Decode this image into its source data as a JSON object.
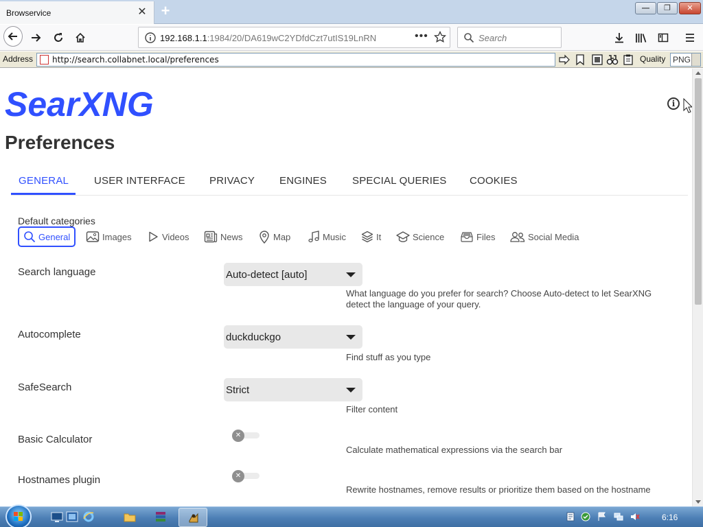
{
  "browser": {
    "tab_title": "Browservice",
    "tab_close": "✕",
    "new_tab": "+",
    "url_host": "192.168.1.1",
    "url_rest": ":1984/20/DA619wC2YDfdCzt7utIS19LnRN",
    "search_placeholder": "Search",
    "more_dots": "•••"
  },
  "addressbar": {
    "label": "Address",
    "url": "http://search.collabnet.local/preferences",
    "quality_label": "Quality",
    "quality_value": "PNG"
  },
  "page": {
    "logo": "SearXNG",
    "info_icon": "i",
    "title": "Preferences",
    "tabs": [
      {
        "label": "GENERAL"
      },
      {
        "label": "USER INTERFACE"
      },
      {
        "label": "PRIVACY"
      },
      {
        "label": "ENGINES"
      },
      {
        "label": "SPECIAL QUERIES"
      },
      {
        "label": "COOKIES"
      }
    ],
    "default_categories_label": "Default categories",
    "categories": [
      {
        "label": "General",
        "icon": "search-icon"
      },
      {
        "label": "Images",
        "icon": "image-icon"
      },
      {
        "label": "Videos",
        "icon": "play-icon"
      },
      {
        "label": "News",
        "icon": "newspaper-icon"
      },
      {
        "label": "Map",
        "icon": "location-pin-icon"
      },
      {
        "label": "Music",
        "icon": "music-note-icon"
      },
      {
        "label": "It",
        "icon": "layers-icon"
      },
      {
        "label": "Science",
        "icon": "school-icon"
      },
      {
        "label": "Files",
        "icon": "file-tray-icon"
      },
      {
        "label": "Social Media",
        "icon": "people-icon"
      }
    ],
    "settings": {
      "search_language": {
        "label": "Search language",
        "value": "Auto-detect [auto]",
        "help": "What language do you prefer for search? Choose Auto-detect to let SearXNG detect the language of your query."
      },
      "autocomplete": {
        "label": "Autocomplete",
        "value": "duckduckgo",
        "help": "Find stuff as you type"
      },
      "safesearch": {
        "label": "SafeSearch",
        "value": "Strict",
        "help": "Filter content"
      },
      "basic_calculator": {
        "label": "Basic Calculator",
        "enabled": false,
        "help": "Calculate mathematical expressions via the search bar"
      },
      "hostnames_plugin": {
        "label": "Hostnames plugin",
        "enabled": false,
        "help": "Rewrite hostnames, remove results or prioritize them based on the hostname"
      }
    }
  },
  "taskbar": {
    "clock": "6:16"
  },
  "colors": {
    "accent": "#3050ff",
    "text": "#333333",
    "select_bg": "#e8e8e8"
  }
}
